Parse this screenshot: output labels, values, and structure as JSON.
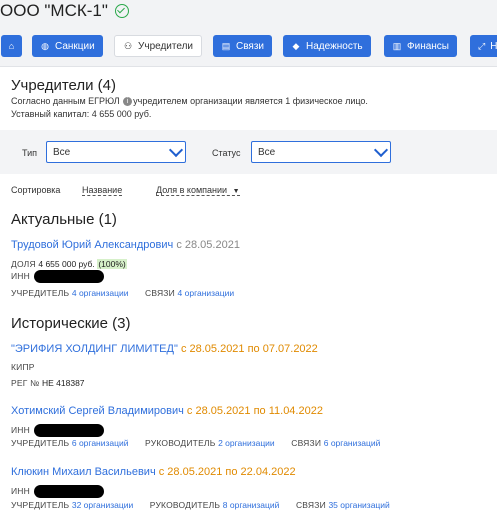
{
  "header": {
    "company_title": "ООО \"МСК-1\""
  },
  "tabs": [
    {
      "label": "",
      "icon": "home-icon",
      "glyph": "⌂"
    },
    {
      "label": "Санкции",
      "icon": "globe-icon",
      "glyph": "◍"
    },
    {
      "label": "Учредители",
      "icon": "people-icon",
      "glyph": "⚇"
    },
    {
      "label": "Связи",
      "icon": "link-icon",
      "glyph": "▤"
    },
    {
      "label": "Надежность",
      "icon": "shield-icon",
      "glyph": "◆"
    },
    {
      "label": "Финансы",
      "icon": "chart-icon",
      "glyph": "▥"
    },
    {
      "label": "Н",
      "icon": "arrows-icon",
      "glyph": "⤢"
    }
  ],
  "section": {
    "title": "Учредители (4)",
    "desc_part1": "Согласно данным ЕГРЮЛ",
    "desc_part2": "учредителем организации является 1 физическое лицо.",
    "capital": "Уставный капитал: 4 655 000 руб."
  },
  "filters": {
    "type_label": "Тип",
    "type_value": "Все",
    "status_label": "Статус",
    "status_value": "Все"
  },
  "sort": {
    "label": "Сортировка",
    "by_name": "Название",
    "by_share": "Доля в компании",
    "arrow": "▼"
  },
  "actual": {
    "title": "Актуальные (1)",
    "items": [
      {
        "name": "Трудовой Юрий Александрович",
        "date": "с 28.05.2021",
        "share_label": "ДОЛЯ",
        "share_value": "4 655 000 руб.",
        "share_pct": "(100%)",
        "inn_label": "ИНН",
        "founder_label": "УЧРЕДИТЕЛЬ",
        "founder_value": "4 организации",
        "links_label": "СВЯЗИ",
        "links_value": "4 организации"
      }
    ]
  },
  "historic": {
    "title": "Исторические (3)",
    "items": [
      {
        "name": "\"ЭРИФИЯ ХОЛДИНГ ЛИМИТЕД\"",
        "date": "с 28.05.2021 по 07.07.2022",
        "country": "КИПР",
        "reg_label": "РЕГ №",
        "reg_value": "НЕ 418387"
      },
      {
        "name": "Хотимский Сергей Владимирович",
        "date": "с 28.05.2021 по 11.04.2022",
        "inn_label": "ИНН",
        "founder_label": "УЧРЕДИТЕЛЬ",
        "founder_value": "6 организаций",
        "manager_label": "РУКОВОДИТЕЛЬ",
        "manager_value": "2 организации",
        "links_label": "СВЯЗИ",
        "links_value": "6 организаций"
      },
      {
        "name": "Клюкин Михаил Васильевич",
        "date": "с 28.05.2021 по 22.04.2022",
        "inn_label": "ИНН",
        "founder_label": "УЧРЕДИТЕЛЬ",
        "founder_value": "32 организации",
        "manager_label": "РУКОВОДИТЕЛЬ",
        "manager_value": "8 организаций",
        "links_label": "СВЯЗИ",
        "links_value": "35 организаций"
      }
    ]
  },
  "colors": {
    "accent": "#2f6fdc",
    "verified": "#2aa84a",
    "history_date": "#e08a00"
  }
}
